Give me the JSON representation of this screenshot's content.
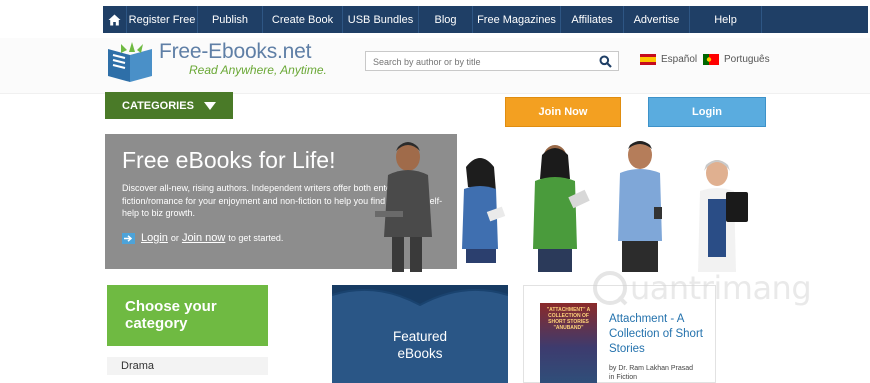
{
  "nav": {
    "items": [
      {
        "label": "Register Free",
        "w": 71
      },
      {
        "label": "Publish",
        "w": 65
      },
      {
        "label": "Create Book",
        "w": 80
      },
      {
        "label": "USB Bundles",
        "w": 76
      },
      {
        "label": "Blog",
        "w": 54
      },
      {
        "label": "Free Magazines",
        "w": 88
      },
      {
        "label": "Affiliates",
        "w": 63
      },
      {
        "label": "Advertise",
        "w": 66
      },
      {
        "label": "Help",
        "w": 72
      }
    ]
  },
  "header": {
    "logo_name": "Free-Ebooks.net",
    "logo_tagline": "Read Anywhere, Anytime.",
    "search_placeholder": "Search by author or by title",
    "lang_es": "Español",
    "lang_pt": "Português"
  },
  "categories_label": "CATEGORIES",
  "join_label": "Join Now",
  "login_label": "Login",
  "hero": {
    "title": "Free eBooks for Life!",
    "body": "Discover all-new, rising authors. Independent writers offer both entertaining fiction/romance for your enjoyment and non-fiction to help you find info from self-help to biz growth.",
    "login_link": "Login",
    "or": "or",
    "join_link": "Join now",
    "suffix": "to get started."
  },
  "choose": {
    "line1": "Choose your",
    "line2": "category"
  },
  "category_first": "Drama",
  "featured": {
    "line1": "Featured",
    "line2": "eBooks"
  },
  "book": {
    "cover_text": "\"ATTACHMENT\" A COLLECTION OF SHORT STORIES \"ANUBAND\"",
    "title": "Attachment - A Collection of Short Stories",
    "author": "by Dr. Ram Lakhan Prasad",
    "genre": "in Fiction"
  },
  "watermark": "uantrimang",
  "colors": {
    "nav_bg": "#1f3f66",
    "accent_green": "#6fba42",
    "categories_green": "#4a7a28",
    "join_orange": "#f3a021",
    "login_blue": "#5aacdf",
    "hero_gray": "#8d8d8d",
    "featured_blue": "#2a5686"
  }
}
